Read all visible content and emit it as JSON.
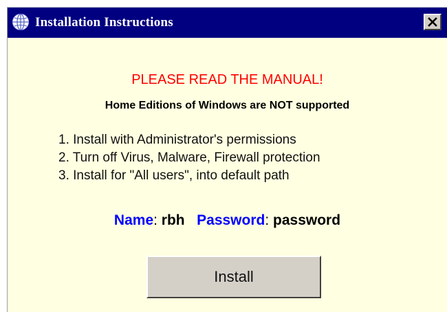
{
  "window": {
    "title": "Installation Instructions",
    "close_label": "✕",
    "title_icon": "globe-info-icon"
  },
  "content": {
    "warning": "PLEASE READ THE MANUAL!",
    "subwarning": "Home Editions of Windows are NOT supported",
    "steps": [
      "1. Install with Administrator's permissions",
      "2. Turn off Virus, Malware, Firewall protection",
      "3. Install for \"All users\", into default path"
    ],
    "credentials": {
      "name_label": "Name",
      "name_value": "rbh",
      "password_label": "Password",
      "password_value": "password"
    }
  },
  "actions": {
    "install_label": "Install"
  },
  "colors": {
    "title_bar": "#000080",
    "background": "#ffffe1",
    "warning": "#ff0000",
    "label_blue": "#0000ff",
    "button_face": "#d4d0c8"
  }
}
